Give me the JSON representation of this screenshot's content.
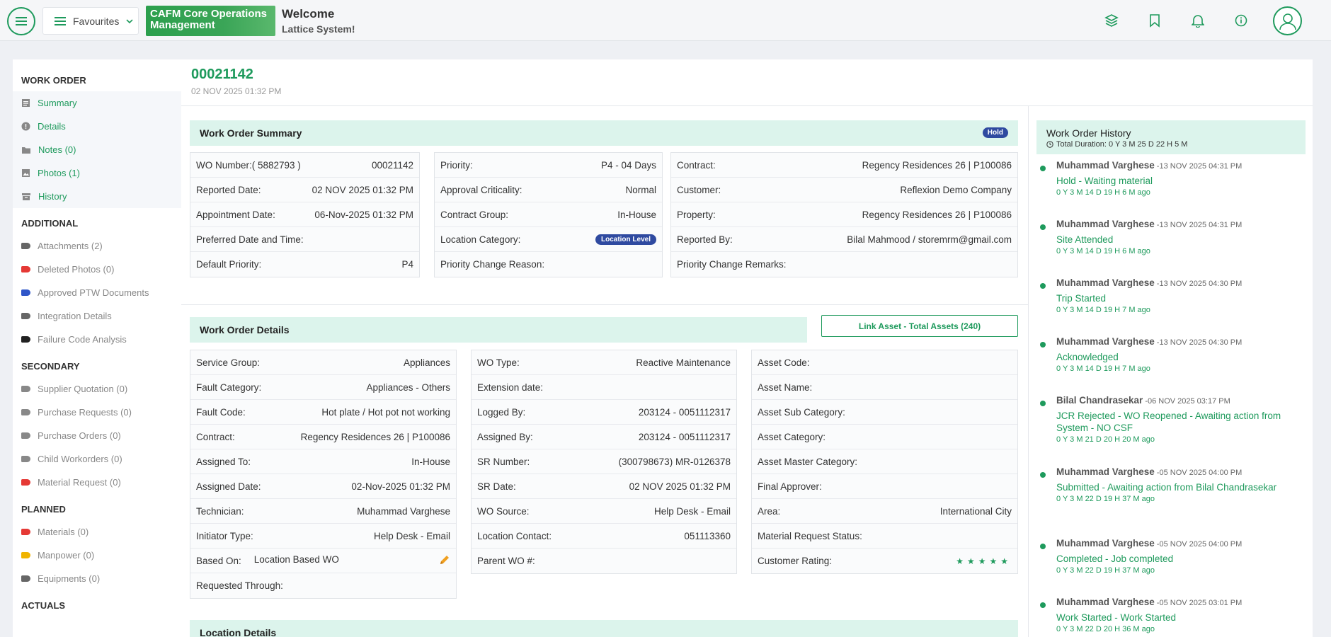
{
  "header": {
    "favourites_label": "Favourites",
    "brand_line1": "CAFM Core Operations",
    "brand_line2": "Management",
    "welcome": "Welcome",
    "system": "Lattice System!"
  },
  "sidebar": {
    "work_order": {
      "title": "WORK ORDER",
      "items": [
        "Summary",
        "Details",
        "Notes (0)",
        "Photos (1)",
        "History"
      ]
    },
    "additional": {
      "title": "ADDITIONAL",
      "items": [
        {
          "label": "Attachments (2)",
          "color": "#666666"
        },
        {
          "label": "Deleted Photos (0)",
          "color": "#e53935"
        },
        {
          "label": "Approved PTW Documents",
          "color": "#2f56c8"
        },
        {
          "label": "Integration Details",
          "color": "#666666"
        },
        {
          "label": "Failure Code Analysis",
          "color": "#222222"
        }
      ]
    },
    "secondary": {
      "title": "SECONDARY",
      "items": [
        {
          "label": "Supplier Quotation (0)",
          "color": "#888888"
        },
        {
          "label": "Purchase Requests (0)",
          "color": "#888888"
        },
        {
          "label": "Purchase Orders (0)",
          "color": "#888888"
        },
        {
          "label": "Child Workorders (0)",
          "color": "#888888"
        },
        {
          "label": "Material Request (0)",
          "color": "#e53935"
        }
      ]
    },
    "planned": {
      "title": "PLANNED",
      "items": [
        {
          "label": "Materials (0)",
          "color": "#e53935"
        },
        {
          "label": "Manpower (0)",
          "color": "#f0b400"
        },
        {
          "label": "Equipments (0)",
          "color": "#666666"
        }
      ]
    },
    "actuals": {
      "title": "ACTUALS"
    }
  },
  "wo": {
    "number": "00021142",
    "date": "02 NOV 2025 01:32 PM"
  },
  "summary": {
    "title": "Work Order Summary",
    "badge": "Hold",
    "col1": [
      {
        "label": "WO Number:( 5882793 )",
        "value": "00021142"
      },
      {
        "label": "Reported Date:",
        "value": "02 NOV 2025 01:32 PM"
      },
      {
        "label": "Appointment Date:",
        "value": "06-Nov-2025 01:32 PM"
      },
      {
        "label": "Preferred Date and Time:",
        "value": ""
      },
      {
        "label": "Default Priority:",
        "value": "P4"
      }
    ],
    "col2": [
      {
        "label": "Priority:",
        "value": "P4 - 04 Days"
      },
      {
        "label": "Approval Criticality:",
        "value": "Normal"
      },
      {
        "label": "Contract Group:",
        "value": "In-House"
      },
      {
        "label": "Location Category:",
        "value": "",
        "badge": "Location Level"
      },
      {
        "label": "Priority Change Reason:",
        "value": ""
      }
    ],
    "col3": [
      {
        "label": "Contract:",
        "value": "Regency Residences 26 | P100086"
      },
      {
        "label": "Customer:",
        "value": "Reflexion Demo Company"
      },
      {
        "label": "Property:",
        "value": "Regency Residences 26 | P100086"
      },
      {
        "label": "Reported By:",
        "value": "Bilal Mahmood / storemrm@gmail.com"
      },
      {
        "label": "Priority Change Remarks:",
        "value": ""
      }
    ]
  },
  "details": {
    "title": "Work Order Details",
    "link_asset": "Link Asset - Total Assets (240)",
    "col1": [
      {
        "label": "Service Group:",
        "value": "Appliances"
      },
      {
        "label": "Fault Category:",
        "value": "Appliances - Others"
      },
      {
        "label": "Fault Code:",
        "value": "Hot plate / Hot pot not working"
      },
      {
        "label": "Contract:",
        "value": "Regency Residences 26 | P100086"
      },
      {
        "label": "Assigned To:",
        "value": "In-House"
      },
      {
        "label": "Assigned Date:",
        "value": "02-Nov-2025 01:32 PM"
      },
      {
        "label": "Technician:",
        "value": "Muhammad Varghese"
      },
      {
        "label": "Initiator Type:",
        "value": "Help Desk - Email"
      },
      {
        "label": "Based On:",
        "value": "Location Based WO"
      },
      {
        "label": "Requested Through:",
        "value": ""
      }
    ],
    "col2": [
      {
        "label": "WO Type:",
        "value": "Reactive Maintenance"
      },
      {
        "label": "Extension date:",
        "value": ""
      },
      {
        "label": "Logged By:",
        "value": "203124 - 0051112317"
      },
      {
        "label": "Assigned By:",
        "value": "203124 - 0051112317"
      },
      {
        "label": "SR Number:",
        "value": "(300798673) MR-0126378"
      },
      {
        "label": "SR Date:",
        "value": "02 NOV 2025 01:32 PM"
      },
      {
        "label": "WO Source:",
        "value": "Help Desk - Email"
      },
      {
        "label": "Location Contact:",
        "value": "051113360"
      },
      {
        "label": "Parent WO #:",
        "value": ""
      }
    ],
    "col3": [
      {
        "label": "Asset Code:",
        "value": ""
      },
      {
        "label": "Asset Name:",
        "value": ""
      },
      {
        "label": "Asset Sub Category:",
        "value": ""
      },
      {
        "label": "Asset Category:",
        "value": ""
      },
      {
        "label": "Asset Master Category:",
        "value": ""
      },
      {
        "label": "Final Approver:",
        "value": ""
      },
      {
        "label": "Area:",
        "value": "International City"
      },
      {
        "label": "Material Request Status:",
        "value": ""
      },
      {
        "label": "Customer Rating:",
        "value": "★★★★★",
        "rating": 5
      }
    ]
  },
  "location": {
    "title": "Location Details"
  },
  "history": {
    "title": "Work Order History",
    "total": "Total Duration: 0 Y 3 M 25 D 22 H 5 M",
    "items": [
      {
        "name": "Muhammad Varghese",
        "date": "-13 NOV 2025 04:31 PM",
        "status": "Hold",
        "sub": " - Waiting material",
        "ago": "0 Y 3 M 14 D 19 H 6 M ago"
      },
      {
        "name": "Muhammad Varghese",
        "date": "-13 NOV 2025 04:31 PM",
        "status": "Site Attended",
        "sub": "",
        "ago": "0 Y 3 M 14 D 19 H 6 M ago"
      },
      {
        "name": "Muhammad Varghese",
        "date": "-13 NOV 2025 04:30 PM",
        "status": "Trip Started",
        "sub": "",
        "ago": "0 Y 3 M 14 D 19 H 7 M ago"
      },
      {
        "name": "Muhammad Varghese",
        "date": "-13 NOV 2025 04:30 PM",
        "status": "Acknowledged",
        "sub": "",
        "ago": "0 Y 3 M 14 D 19 H 7 M ago"
      },
      {
        "name": "Bilal Chandrasekar",
        "date": "-06 NOV 2025 03:17 PM",
        "status": "JCR Rejected - WO Reopened - Awaiting action from System",
        "sub": " - NO CSF",
        "ago": "0 Y 3 M 21 D 20 H 20 M ago"
      },
      {
        "name": "Muhammad Varghese",
        "date": "-05 NOV 2025 04:00 PM",
        "status": "Submitted - Awaiting action from Bilal Chandrasekar",
        "sub": "",
        "ago": "0 Y 3 M 22 D 19 H 37 M ago"
      },
      {
        "name": "Muhammad Varghese",
        "date": "-05 NOV 2025 04:00 PM",
        "status": "Completed",
        "sub": " - Job completed",
        "ago": "0 Y 3 M 22 D 19 H 37 M ago"
      },
      {
        "name": "Muhammad Varghese",
        "date": "-05 NOV 2025 03:01 PM",
        "status": "Work Started",
        "sub": " - Work Started",
        "ago": "0 Y 3 M 22 D 20 H 36 M ago"
      }
    ]
  },
  "icons": {
    "menu": "hamburger-icon",
    "layers": "layers-icon",
    "bookmark": "bookmark-icon",
    "bell": "bell-icon",
    "info": "info-icon",
    "user": "user-icon"
  },
  "colors": {
    "accent": "#1e9a5c",
    "section_bg": "#dcf4ec",
    "badge": "#2f4aa0"
  }
}
